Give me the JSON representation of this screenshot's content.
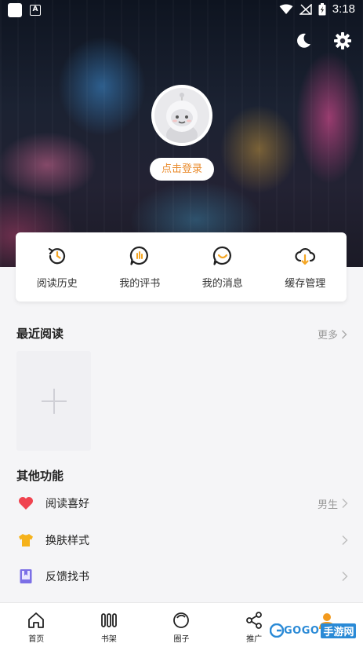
{
  "status_bar": {
    "time": "3:18",
    "app_icon_letter": "A"
  },
  "header": {
    "night_mode_icon": "moon-icon",
    "settings_icon": "gear-icon",
    "login_label": "点击登录"
  },
  "quick_menu": [
    {
      "label": "阅读历史",
      "icon": "history-icon"
    },
    {
      "label": "我的评书",
      "icon": "comment-icon"
    },
    {
      "label": "我的消息",
      "icon": "message-icon"
    },
    {
      "label": "缓存管理",
      "icon": "cloud-download-icon"
    }
  ],
  "recent": {
    "title": "最近阅读",
    "more_label": "更多"
  },
  "other": {
    "title": "其他功能",
    "items": [
      {
        "label": "阅读喜好",
        "value": "男生",
        "icon": "heart-icon",
        "color": "#f0434f"
      },
      {
        "label": "换肤样式",
        "value": "",
        "icon": "shirt-icon",
        "color": "#f5b21b"
      },
      {
        "label": "反馈找书",
        "value": "",
        "icon": "book-icon",
        "color": "#7b6fe6"
      }
    ]
  },
  "tabbar": [
    {
      "label": "首页",
      "icon": "home-icon"
    },
    {
      "label": "书架",
      "icon": "bookshelf-icon"
    },
    {
      "label": "圈子",
      "icon": "circle-icon"
    },
    {
      "label": "推广",
      "icon": "share-icon"
    },
    {
      "label": "",
      "icon": "profile-icon"
    }
  ],
  "watermark": {
    "brand": "GOGO",
    "suffix": "手游网"
  },
  "colors": {
    "accent": "#e98a2a",
    "watermark": "#2a8ad6"
  }
}
